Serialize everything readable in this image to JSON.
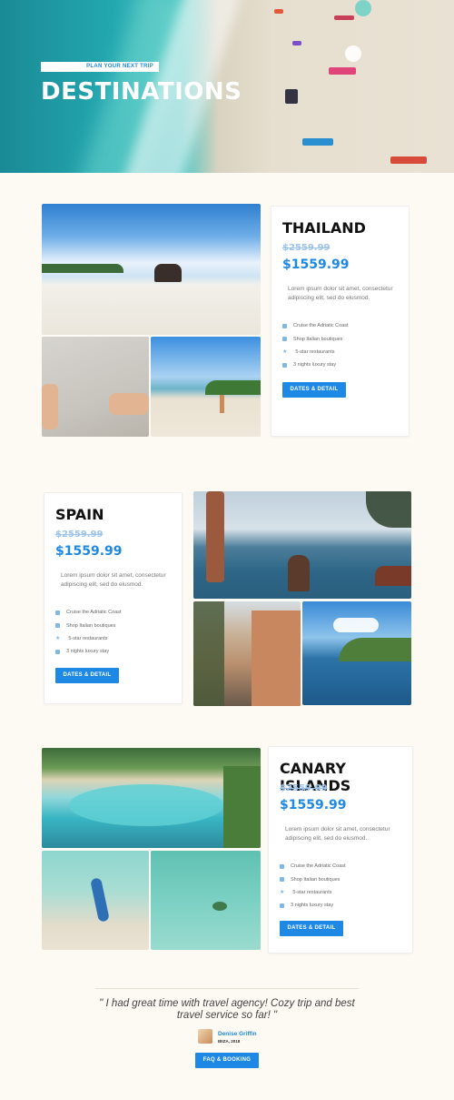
{
  "hero": {
    "kicker": "PLAN YOUR NEXT TRIP",
    "title": "DESTINATIONS"
  },
  "destinations": [
    {
      "name": "THAILAND",
      "old_price": "$2559.99",
      "price": "$1559.99",
      "description": "Lorem ipsum dolor sit amet, consectetur adipiscing elit, sed do eiusmod.",
      "features": [
        "Cruise the Adriatic Coast",
        "Shop Italian boutiques",
        "5-star restaurants",
        "3 nights luxury stay"
      ],
      "button": "DATES & DETAIL"
    },
    {
      "name": "SPAIN",
      "old_price": "$2559.99",
      "price": "$1559.99",
      "description": "Lorem ipsum dolor sit amet, consectetur adipiscing elit, sed do eiusmod.",
      "features": [
        "Cruise the Adriatic Coast",
        "Shop Italian boutiques",
        "5-star restaurants",
        "3 nights luxury stay"
      ],
      "button": "DATES & DETAIL"
    },
    {
      "name": "CANARY ISLANDS",
      "old_price": "$2559.99",
      "price": "$1559.99",
      "description": "Lorem ipsum dolor sit amet, consectetur adipiscing elit, sed do eiusmod.",
      "features": [
        "Cruise the Adriatic Coast",
        "Shop Italian boutiques",
        "5-star restaurants",
        "3 nights luxury stay"
      ],
      "button": "DATES & DETAIL"
    }
  ],
  "testimonial": {
    "quote": "\" I had great time with travel agency! Cozy trip and best travel service so far! \"",
    "author": "Denise Griffin",
    "location": "IBIZA, 2018",
    "button": "FAQ & BOOKING"
  },
  "colors": {
    "accent": "#1e88e5",
    "background": "#fdfaf3",
    "old_price": "#9ec4ee"
  },
  "feature_icons": [
    "ship-icon",
    "shopping-bag-icon",
    "star-icon",
    "bed-icon"
  ]
}
